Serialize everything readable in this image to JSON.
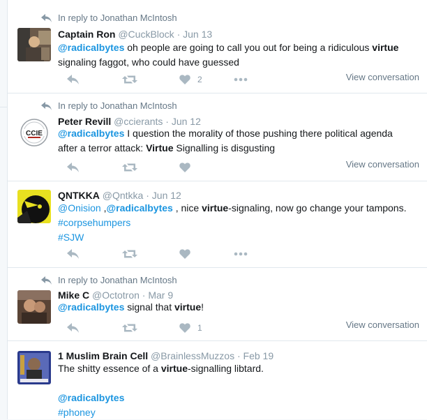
{
  "tweets": [
    {
      "reply_context": "In reply to Jonathan McIntosh",
      "fullname": "Captain Ron",
      "handle_date": "@CuckBlock · Jun 13",
      "lines": [
        [
          {
            "t": "@radicalbytes",
            "c": "mention"
          },
          {
            "t": " oh people are going to call you out for being a ridiculous "
          },
          {
            "t": "virtue",
            "c": "kw"
          }
        ],
        [
          {
            "t": "signaling faggot, who could have guessed"
          }
        ]
      ],
      "like_count": "2",
      "view_conversation": "View conversation"
    },
    {
      "reply_context": "In reply to Jonathan McIntosh",
      "fullname": "Peter Revill",
      "handle_date": "@ccierants · Jun 12",
      "lines": [
        [
          {
            "t": "@radicalbytes",
            "c": "mention"
          },
          {
            "t": " I question the morality of those pushing there political agenda"
          }
        ],
        [
          {
            "t": "after a terror attack: "
          },
          {
            "t": "Virtue",
            "c": "kw"
          },
          {
            "t": " Signalling is disgusting"
          }
        ]
      ],
      "like_count": "",
      "view_conversation": "View conversation",
      "avatar_text": "CCIE"
    },
    {
      "reply_context": "",
      "fullname": "QNTKKA",
      "handle_date": "@Qntkka · Jun 12",
      "lines": [
        [
          {
            "t": "@Onision",
            "c": "tag"
          },
          {
            "t": " ,"
          },
          {
            "t": "@radicalbytes",
            "c": "mention"
          },
          {
            "t": " , nice "
          },
          {
            "t": "virtue",
            "c": "kw"
          },
          {
            "t": "-signaling, now go change your tampons."
          }
        ],
        [
          {
            "t": "#corpsehumpers",
            "c": "tag"
          }
        ],
        [
          {
            "t": "#SJW",
            "c": "tag"
          }
        ]
      ],
      "like_count": "",
      "view_conversation": ""
    },
    {
      "reply_context": "In reply to Jonathan McIntosh",
      "fullname": "Mike C",
      "handle_date": "@Octotron · Mar 9",
      "lines": [
        [
          {
            "t": "@radicalbytes",
            "c": "mention"
          },
          {
            "t": " signal that "
          },
          {
            "t": "virtue",
            "c": "kw"
          },
          {
            "t": "!"
          }
        ]
      ],
      "like_count": "1",
      "view_conversation": "View conversation"
    },
    {
      "reply_context": "",
      "fullname": "1 Muslim Brain Cell",
      "handle_date": "@BrainlessMuzzos · Feb 19",
      "lines": [
        [
          {
            "t": "The shitty essence of a "
          },
          {
            "t": "virtue",
            "c": "kw"
          },
          {
            "t": "-signalling libtard."
          }
        ],
        [
          {
            "t": " "
          }
        ],
        [
          {
            "t": "@radicalbytes",
            "c": "mention"
          }
        ],
        [
          {
            "t": "#phoney",
            "c": "tag"
          }
        ]
      ],
      "like_count": "",
      "view_conversation": ""
    }
  ],
  "colors": {
    "link": "#1b95e0",
    "meta": "#8899a6",
    "icon": "#aab8c2",
    "border": "#e1e8ed"
  },
  "icons": [
    "reply-arrow-icon",
    "reply-icon",
    "retweet-icon",
    "heart-icon",
    "more-icon"
  ]
}
